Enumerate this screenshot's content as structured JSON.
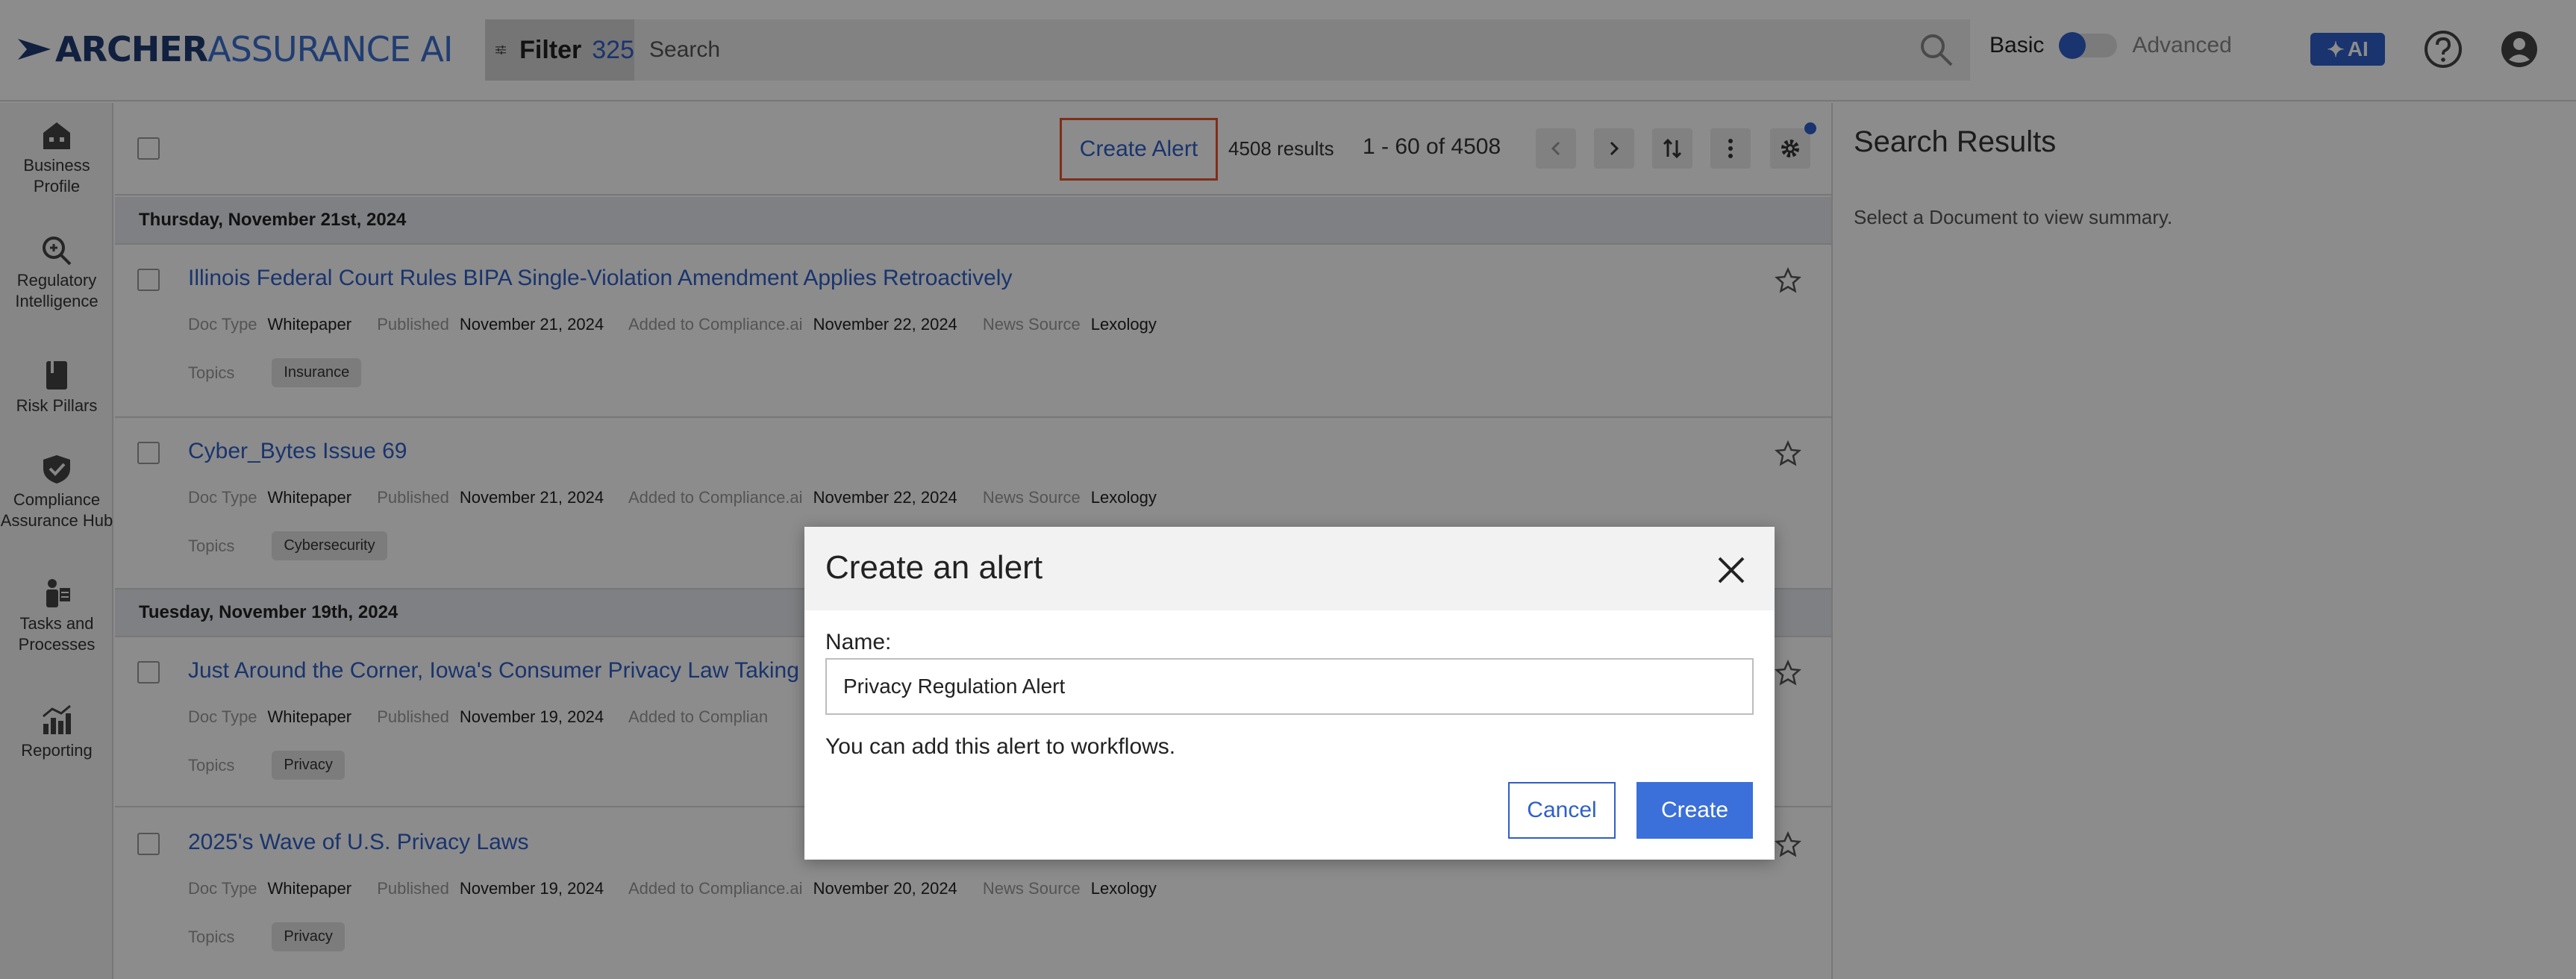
{
  "header": {
    "logo_bold": "ARCHER",
    "logo_light": "ASSURANCE AI",
    "filter_label": "Filter",
    "filter_count": "325",
    "search_placeholder": "Search",
    "mode_basic": "Basic",
    "mode_advanced": "Advanced",
    "ai_label": "AI"
  },
  "nav": {
    "items": [
      {
        "label": "Business Profile",
        "icon": "building-icon"
      },
      {
        "label": "Regulatory Intelligence",
        "icon": "search-icon"
      },
      {
        "label": "Risk Pillars",
        "icon": "book-icon"
      },
      {
        "label": "Compliance Assurance Hub",
        "icon": "shield-icon"
      },
      {
        "label": "Tasks and Processes",
        "icon": "tasks-icon"
      },
      {
        "label": "Reporting",
        "icon": "chart-icon"
      }
    ]
  },
  "toolbar": {
    "create_alert": "Create Alert",
    "results_count": "4508 results",
    "range": "1 - 60 of 4508"
  },
  "dates": [
    "Thursday, November 21st, 2024",
    "Tuesday, November 19th, 2024"
  ],
  "meta_labels": {
    "doc_type": "Doc Type",
    "published": "Published",
    "added": "Added to Compliance.ai",
    "source": "News Source",
    "topics": "Topics"
  },
  "documents": [
    {
      "title": "Illinois Federal Court Rules BIPA Single-Violation Amendment Applies Retroactively",
      "doc_type": "Whitepaper",
      "published": "November 21, 2024",
      "added": "November 22, 2024",
      "source": "Lexology",
      "topic": "Insurance"
    },
    {
      "title": "Cyber_Bytes Issue 69",
      "doc_type": "Whitepaper",
      "published": "November 21, 2024",
      "added": "November 22, 2024",
      "source": "Lexology",
      "topic": "Cybersecurity"
    },
    {
      "title": "Just Around the Corner, Iowa's Consumer Privacy Law Taking E",
      "doc_type": "Whitepaper",
      "published": "November 19, 2024",
      "added": "Added to Complian",
      "source": "",
      "topic": "Privacy"
    },
    {
      "title": "2025's Wave of U.S. Privacy Laws",
      "doc_type": "Whitepaper",
      "published": "November 19, 2024",
      "added": "November 20, 2024",
      "source": "Lexology",
      "topic": "Privacy"
    }
  ],
  "right_panel": {
    "title": "Search Results",
    "subtitle": "Select a Document to view summary."
  },
  "modal": {
    "title": "Create an alert",
    "name_label": "Name:",
    "name_value": "Privacy Regulation Alert",
    "hint": "You can add this alert to workflows.",
    "cancel": "Cancel",
    "create": "Create"
  },
  "colors": {
    "accent": "#2f5fc8",
    "highlight_border": "#e8542a"
  }
}
